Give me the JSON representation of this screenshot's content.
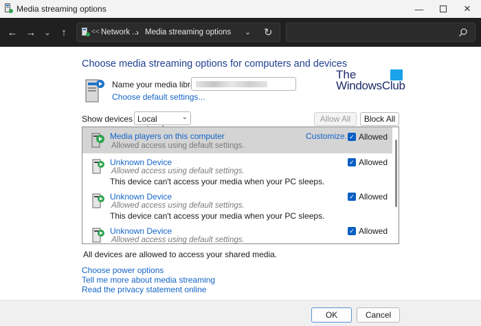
{
  "window": {
    "title": "Media streaming options",
    "minimize_icon": "minimize-icon",
    "maximize_icon": "maximize-icon",
    "close_icon": "close-icon"
  },
  "navigation": {
    "breadcrumb_overflow": "<<",
    "breadcrumb": [
      "Network ...",
      "Media streaming options"
    ],
    "search_placeholder": ""
  },
  "main": {
    "heading": "Choose media streaming options for computers and devices",
    "library_label": "Name your media library:",
    "default_settings_link": "Choose default settings...",
    "show_devices_label": "Show devices on:",
    "show_devices_value": "Local network",
    "allow_all_label": "Allow All",
    "block_all_label": "Block All",
    "devices": [
      {
        "name": "Media players on this computer",
        "status": "Allowed access using default settings.",
        "customize": "Customize...",
        "allowed_label": "Allowed",
        "checked": true,
        "note": ""
      },
      {
        "name": "Unknown Device",
        "status": "Allowed access using default settings.",
        "customize": "",
        "allowed_label": "Allowed",
        "checked": true,
        "note": "This device can't access your media when your PC sleeps."
      },
      {
        "name": "Unknown Device",
        "status": "Allowed access using default settings.",
        "customize": "",
        "allowed_label": "Allowed",
        "checked": true,
        "note": "This device can't access your media when your PC sleeps."
      },
      {
        "name": "Unknown Device",
        "status": "Allowed access using default settings.",
        "customize": "",
        "allowed_label": "Allowed",
        "checked": true,
        "note": ""
      }
    ],
    "status_text": "All devices are allowed to access your shared media.",
    "links": {
      "power": "Choose power options",
      "more": "Tell me more about media streaming",
      "privacy": "Read the privacy statement online"
    }
  },
  "logo": {
    "line1": "The",
    "line2": "WindowsClub"
  },
  "footer": {
    "ok_label": "OK",
    "cancel_label": "Cancel"
  },
  "colors": {
    "heading": "#1e3e8e",
    "link": "#1264c8",
    "nav_background": "#202020",
    "checkbox": "#0a5fc2",
    "selected_row": "#d4d4d4"
  }
}
